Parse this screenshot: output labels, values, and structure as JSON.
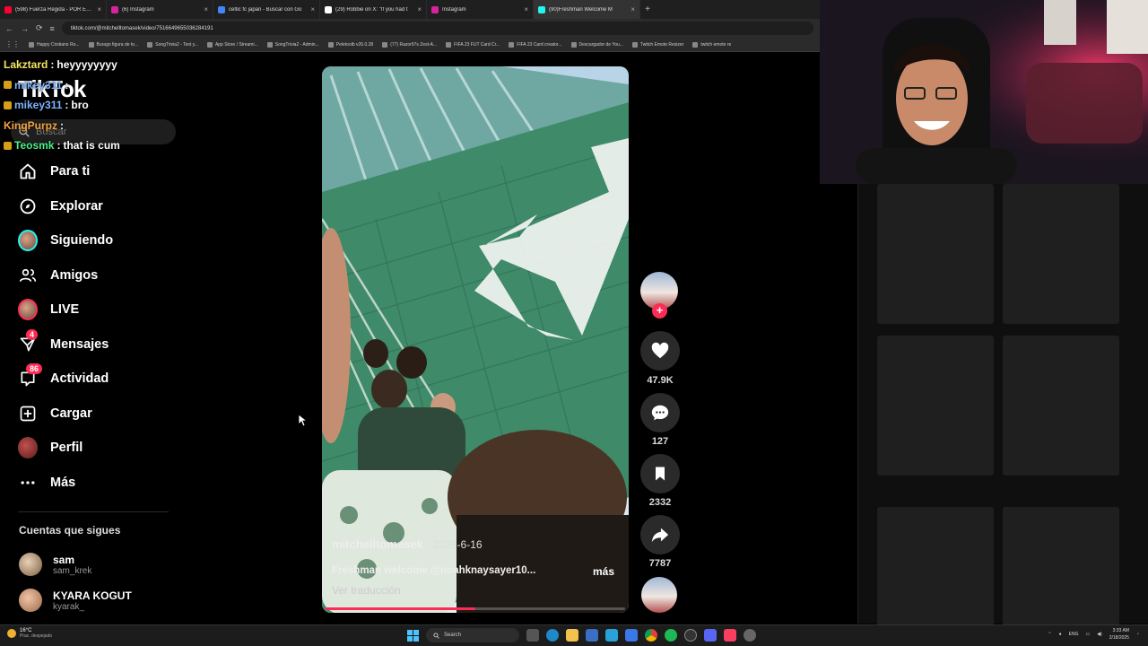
{
  "browser": {
    "tabs": [
      {
        "title": "(598) Fuerza Regida - POR ESO",
        "color": "#ff0033",
        "active": false
      },
      {
        "title": "(6) Instagram",
        "color": "#d6249f",
        "active": false
      },
      {
        "title": "celtic fc japan - Buscar con Go",
        "color": "#4285f4",
        "active": false
      },
      {
        "title": "(29) Robbie on X: \"If you had t",
        "color": "#ffffff",
        "active": false
      },
      {
        "title": "Instagram",
        "color": "#d6249f",
        "active": false
      },
      {
        "title": "(90)Freshman Welcome M",
        "color": "#25f4ee",
        "active": true
      }
    ],
    "new_tab": "+",
    "close": "×",
    "url": "tiktok.com/@mitchelltomasek/video/7516649655036284191",
    "bookmarks": [
      "Happy Cristiano Ro...",
      "Burago figura de to...",
      "SongTrivia2 - Test y...",
      "App Store / Streami...",
      "SongTrivia2 - Admin...",
      "Peletoolb v26.0.28",
      "(77) Razor97s Zest-A...",
      "FIFA 23 FUT Card Cr...",
      "FIFA 23 Card creator...",
      "Descargador de You...",
      "Twitch Emote Resizer",
      "twitch emote re"
    ]
  },
  "chat": [
    {
      "user": "Lakztard",
      "color": "#f5e663",
      "message": "heyyyyyyyy"
    },
    {
      "user": "mikey311",
      "color": "#7fb3ff",
      "message": ""
    },
    {
      "user": "mikey311",
      "color": "#7fb3ff",
      "message": "bro"
    },
    {
      "user": "KingPurpz",
      "color": "#f4a340",
      "message": ""
    },
    {
      "user": "Teosmk",
      "color": "#4cf08a",
      "message": "that is cum"
    }
  ],
  "tiktok": {
    "logo": "TikTok",
    "search_placeholder": "Buscar",
    "nav": [
      {
        "label": "Para ti",
        "icon": "home-icon"
      },
      {
        "label": "Explorar",
        "icon": "compass-icon"
      },
      {
        "label": "Siguiendo",
        "icon": "following-avatar-icon"
      },
      {
        "label": "Amigos",
        "icon": "friends-icon"
      },
      {
        "label": "LIVE",
        "icon": "live-avatar-icon"
      },
      {
        "label": "Mensajes",
        "icon": "messages-icon",
        "badge": "4"
      },
      {
        "label": "Actividad",
        "icon": "activity-icon",
        "badge": "86"
      },
      {
        "label": "Cargar",
        "icon": "upload-icon"
      },
      {
        "label": "Perfil",
        "icon": "profile-avatar-icon"
      },
      {
        "label": "Más",
        "icon": "more-icon"
      }
    ],
    "following_title": "Cuentas que sigues",
    "following": [
      {
        "name": "sam",
        "handle": "sam_krek"
      },
      {
        "name": "KYARA KOGUT",
        "handle": "kyarak_"
      }
    ]
  },
  "video": {
    "author": "mitchelltomasek",
    "date": "· 2025-6-16",
    "caption": "Freshman welcome @noahknaysayer10...",
    "more": "más",
    "translate": "Ver traducción",
    "progress": 0.5,
    "likes": "47.9K",
    "comments": "127",
    "saves": "2332",
    "shares": "7787"
  },
  "taskbar": {
    "weather_temp": "16°C",
    "weather_desc": "Prac. despejado",
    "search": "Search",
    "lang": "ENG",
    "time": "3:33 AM",
    "date": "2/18/2025"
  }
}
